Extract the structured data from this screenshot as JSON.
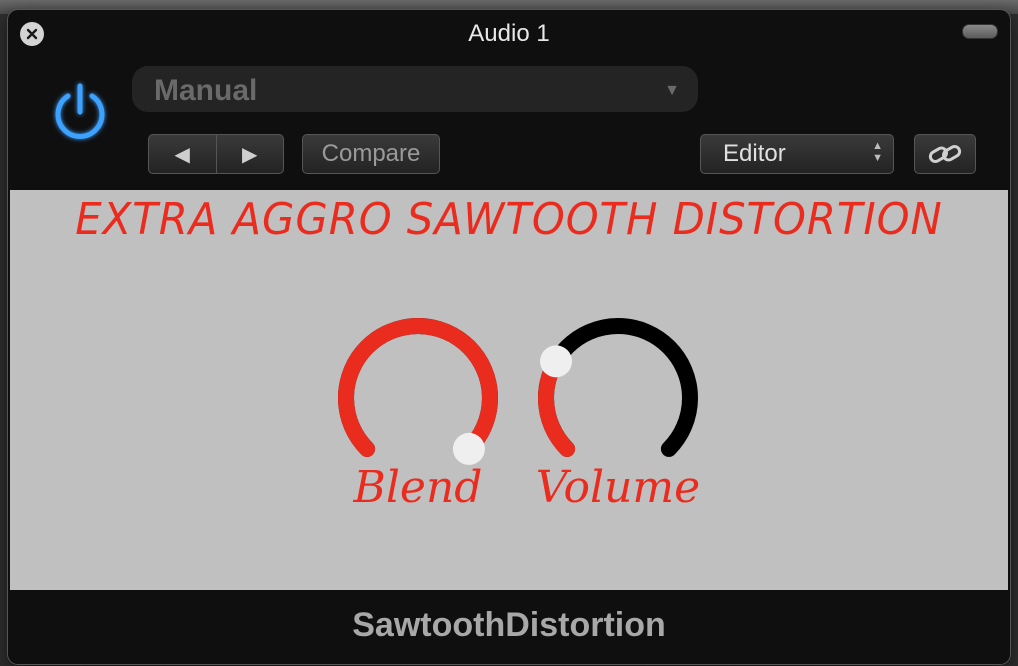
{
  "window": {
    "title": "Audio 1"
  },
  "header": {
    "preset_value": "Manual",
    "compare_label": "Compare",
    "view_value": "Editor",
    "prev_glyph": "◀",
    "next_glyph": "▶"
  },
  "plugin": {
    "title": "EXTRA AGGRO SAWTOOTH DISTORTION",
    "accent_color": "#ea2c1f",
    "knobs": [
      {
        "label": "Blend",
        "value": 1.0
      },
      {
        "label": "Volume",
        "value": 0.28
      }
    ]
  },
  "footer": {
    "plugin_name": "SawtoothDistortion"
  },
  "icons": {
    "close": "close-icon",
    "power": "power-icon",
    "link": "link-icon"
  }
}
